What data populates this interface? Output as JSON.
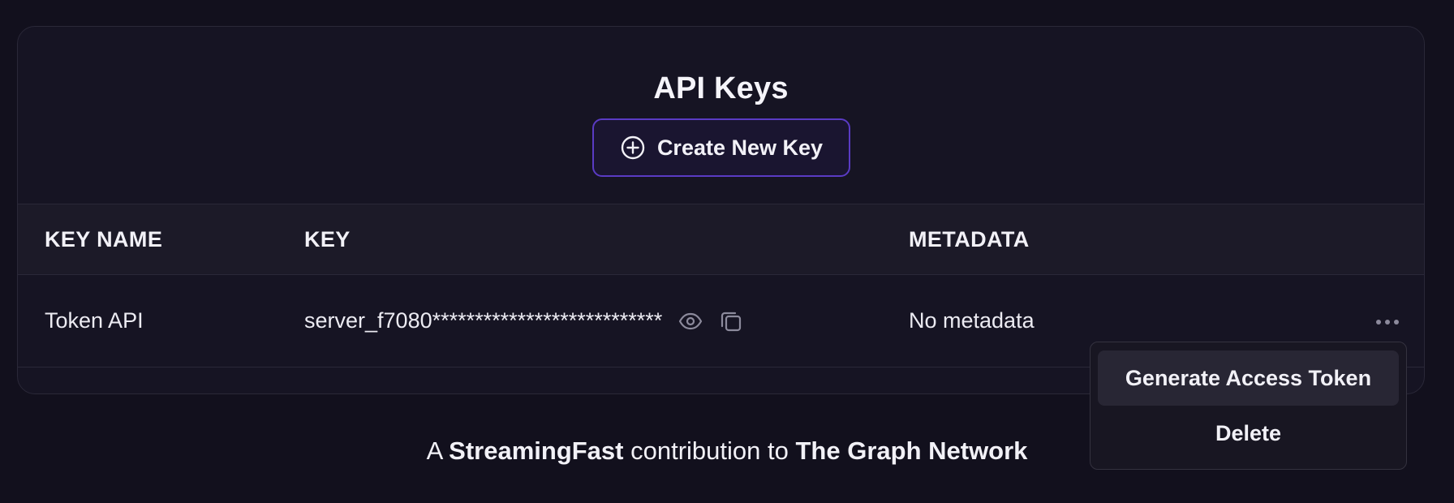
{
  "card": {
    "title": "API Keys",
    "create_button_label": "Create New Key"
  },
  "table": {
    "columns": [
      "KEY NAME",
      "KEY",
      "METADATA"
    ],
    "rows": [
      {
        "name": "Token API",
        "key": "server_f7080***************************",
        "metadata": "No metadata"
      }
    ]
  },
  "row_menu": {
    "items": [
      "Generate Access Token",
      "Delete"
    ]
  },
  "footer": {
    "prefix": "A",
    "org": "StreamingFast",
    "middle": "contribution to",
    "network": "The Graph Network"
  },
  "colors": {
    "background": "#12101d",
    "card": "#161423",
    "accent": "#5a3bc4"
  },
  "icons": {
    "create": "plus-circle-icon",
    "reveal": "eye-icon",
    "copy": "copy-icon",
    "more": "more-horizontal-icon"
  }
}
